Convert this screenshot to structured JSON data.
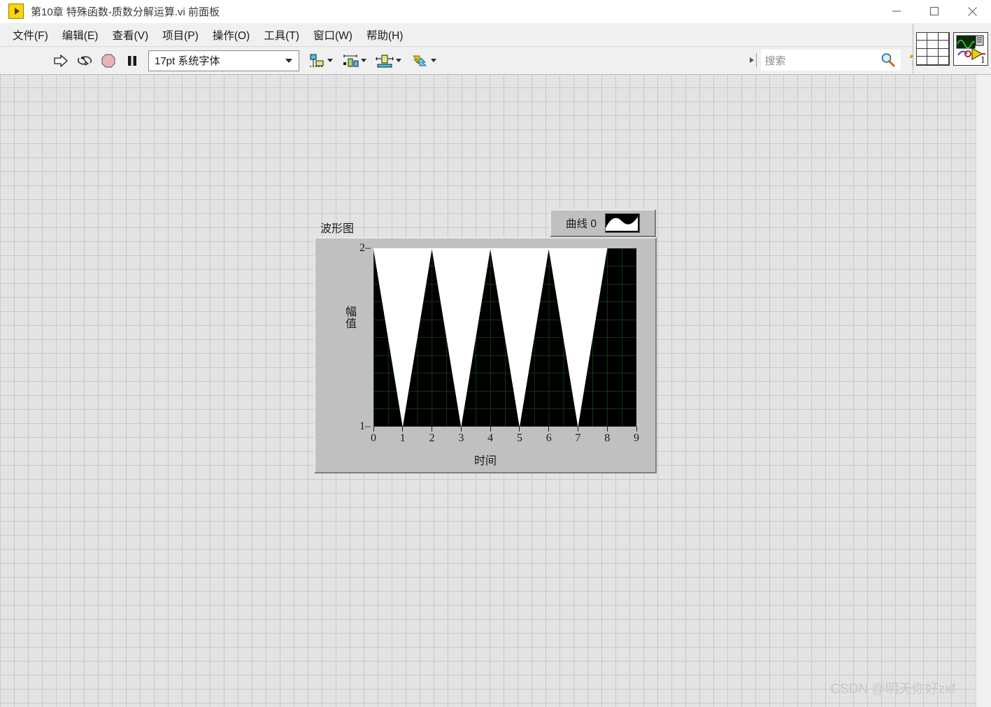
{
  "window": {
    "title": "第10章 特殊函数-质数分解运算.vi 前面板",
    "app_icon": "labview-vi-icon",
    "controls": [
      {
        "name": "minimize",
        "glyph": "minimize-icon"
      },
      {
        "name": "maximize",
        "glyph": "maximize-icon"
      },
      {
        "name": "close",
        "glyph": "close-icon"
      }
    ]
  },
  "menubar": {
    "items": [
      {
        "label": "文件(F)",
        "name": "file"
      },
      {
        "label": "编辑(E)",
        "name": "edit"
      },
      {
        "label": "查看(V)",
        "name": "view"
      },
      {
        "label": "项目(P)",
        "name": "project"
      },
      {
        "label": "操作(O)",
        "name": "operate"
      },
      {
        "label": "工具(T)",
        "name": "tools"
      },
      {
        "label": "窗口(W)",
        "name": "window"
      },
      {
        "label": "帮助(H)",
        "name": "help"
      }
    ]
  },
  "toolbar": {
    "run_icon": "run-arrow-icon",
    "run_continuous_icon": "run-continuously-icon",
    "abort_icon": "abort-execution-icon",
    "pause_icon": "pause-icon",
    "font_selector_value": "17pt 系统字体",
    "align_icon": "align-objects-icon",
    "distribute_icon": "distribute-objects-icon",
    "resize_icon": "resize-objects-icon",
    "reorder_icon": "reorder-objects-icon",
    "search_placeholder": "搜索",
    "search_value": "",
    "search_icon": "magnifier-icon",
    "help_icon": "context-help-icon",
    "connector_pane_icon": "connector-pane-icon",
    "vi_icon_label": "1"
  },
  "panel": {
    "graph": {
      "label": "波形图",
      "legend": {
        "plot_name": "曲线 0",
        "swatch_icon": "plot-style-swatch"
      },
      "xlabel": "时间",
      "ylabel": "幅值",
      "xticks": [
        "0",
        "1",
        "2",
        "3",
        "4",
        "5",
        "6",
        "7",
        "8",
        "9"
      ],
      "yticks": [
        "2",
        "1"
      ]
    },
    "watermark": "CSDN @明天你好zxf"
  },
  "colors": {
    "plot_background": "#000000",
    "plot_grid": "#1f6b1f",
    "plot_trace": "#ffffff",
    "panel_background": "#e3e3e3",
    "panel_grid": "#c9c9c9",
    "widget_face": "#c0c0c0",
    "titlebar_text": "#3a3a3a",
    "accent_yellow": "#ffd400"
  },
  "chart_data": {
    "type": "line",
    "title": "波形图",
    "xlabel": "时间",
    "ylabel": "幅值",
    "xlim": [
      0,
      9
    ],
    "ylim": [
      1,
      2
    ],
    "xticks": [
      0,
      1,
      2,
      3,
      4,
      5,
      6,
      7,
      8,
      9
    ],
    "yticks": [
      1,
      2
    ],
    "grid": true,
    "legend": [
      "曲线 0"
    ],
    "legend_position": "top-right outside",
    "description": "Dense high-frequency oscillation whose envelope forms repeating V shapes: the trace fills from y=2 down to minima of y=1 at x=1,3,5,7 and returns to y=2 at x=2,4,6,8. Rendered as a white trace on a black plot background with green gridlines.",
    "series": [
      {
        "name": "曲线 0",
        "envelope_upper": [
          2,
          2,
          2,
          2,
          2,
          2,
          2,
          2,
          2,
          2
        ],
        "envelope_lower": [
          2,
          1,
          2,
          1,
          2,
          1,
          2,
          1,
          2,
          2
        ],
        "x": [
          0,
          1,
          2,
          3,
          4,
          5,
          6,
          7,
          8,
          9
        ]
      }
    ]
  }
}
